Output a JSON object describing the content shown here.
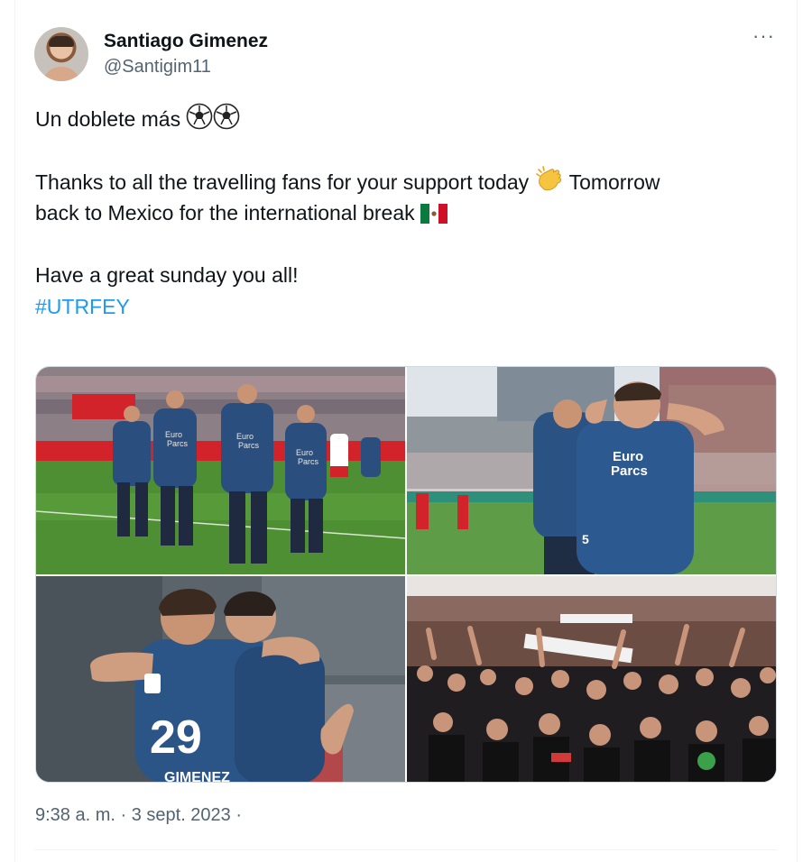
{
  "author": {
    "name": "Santiago Gimenez",
    "handle": "@Santigim11"
  },
  "tweet": {
    "line1": "Un doblete más",
    "line2a": "Thanks to all the travelling fans for your support today",
    "line2b": "Tomorrow",
    "line3": "back to Mexico for the international break",
    "line4": "Have a great sunday you all!",
    "hashtag": "#UTRFEY"
  },
  "media": {
    "count": 4,
    "photos": [
      "players-celebrating-photo",
      "player-celebration-photo",
      "players-hugging-photo",
      "fans-supporting-photo"
    ],
    "jersey_sponsor": "Euro Parcs",
    "jersey_number": "29",
    "jersey_name": "GIMENEZ"
  },
  "footer": {
    "timestamp": "9:38 a. m. · 3 sept. 2023 ·"
  },
  "colors": {
    "accent": "#1d9bf0",
    "secondary_text": "#536471",
    "jersey": "#2a4f7e"
  }
}
